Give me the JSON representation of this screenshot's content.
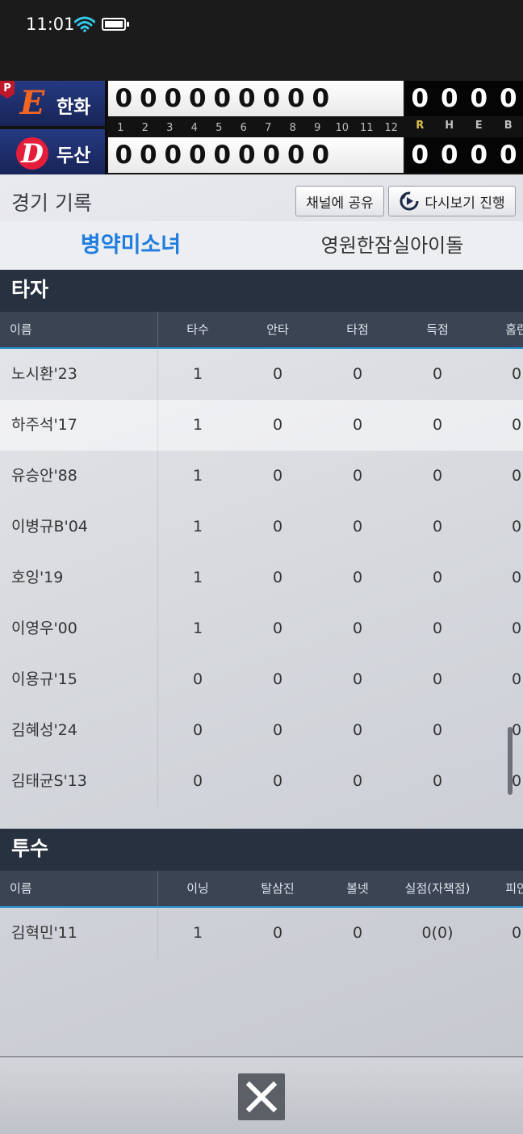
{
  "status": {
    "time": "11:01"
  },
  "scoreboard": {
    "away": {
      "name": "한화",
      "logo": "E",
      "badge": "P",
      "innings": [
        "0",
        "0",
        "0",
        "0",
        "0",
        "0",
        "0",
        "0",
        "0"
      ],
      "rheb": [
        "0",
        "0",
        "0",
        "0"
      ]
    },
    "home": {
      "name": "두산",
      "logo": "D",
      "innings": [
        "0",
        "0",
        "0",
        "0",
        "0",
        "0",
        "0",
        "0",
        "0"
      ],
      "rheb": [
        "0",
        "0",
        "0",
        "0"
      ]
    },
    "inning_labels": [
      "1",
      "2",
      "3",
      "4",
      "5",
      "6",
      "7",
      "8",
      "9",
      "10",
      "11",
      "12"
    ],
    "rheb_labels": [
      "R",
      "H",
      "E",
      "B"
    ],
    "colors": {
      "away_logo": "#f26522",
      "home_logo_bg": "#e41e3a",
      "run_label": "#d8c04a"
    }
  },
  "record": {
    "title": "경기 기록",
    "share_label": "채널에 공유",
    "replay_label": "다시보기 진행"
  },
  "tabs": {
    "active": "병약미소녀",
    "inactive": "영원한잠실아이돌"
  },
  "batters": {
    "title": "타자",
    "headers": [
      "이름",
      "타수",
      "안타",
      "타점",
      "득점",
      "홈런"
    ],
    "rows": [
      [
        "노시환'23",
        "1",
        "0",
        "0",
        "0",
        "0"
      ],
      [
        "하주석'17",
        "1",
        "0",
        "0",
        "0",
        "0"
      ],
      [
        "유승안'88",
        "1",
        "0",
        "0",
        "0",
        "0"
      ],
      [
        "이병규B'04",
        "1",
        "0",
        "0",
        "0",
        "0"
      ],
      [
        "호잉'19",
        "1",
        "0",
        "0",
        "0",
        "0"
      ],
      [
        "이영우'00",
        "1",
        "0",
        "0",
        "0",
        "0"
      ],
      [
        "이용규'15",
        "0",
        "0",
        "0",
        "0",
        "0"
      ],
      [
        "김혜성'24",
        "0",
        "0",
        "0",
        "0",
        "0"
      ],
      [
        "김태균S'13",
        "0",
        "0",
        "0",
        "0",
        "0"
      ]
    ]
  },
  "pitchers": {
    "title": "투수",
    "headers": [
      "이름",
      "이닝",
      "탈삼진",
      "볼넷",
      "실점(자책점)",
      "피안"
    ],
    "rows": [
      [
        "김혁민'11",
        "1",
        "0",
        "0",
        "0(0)",
        "0"
      ]
    ]
  }
}
